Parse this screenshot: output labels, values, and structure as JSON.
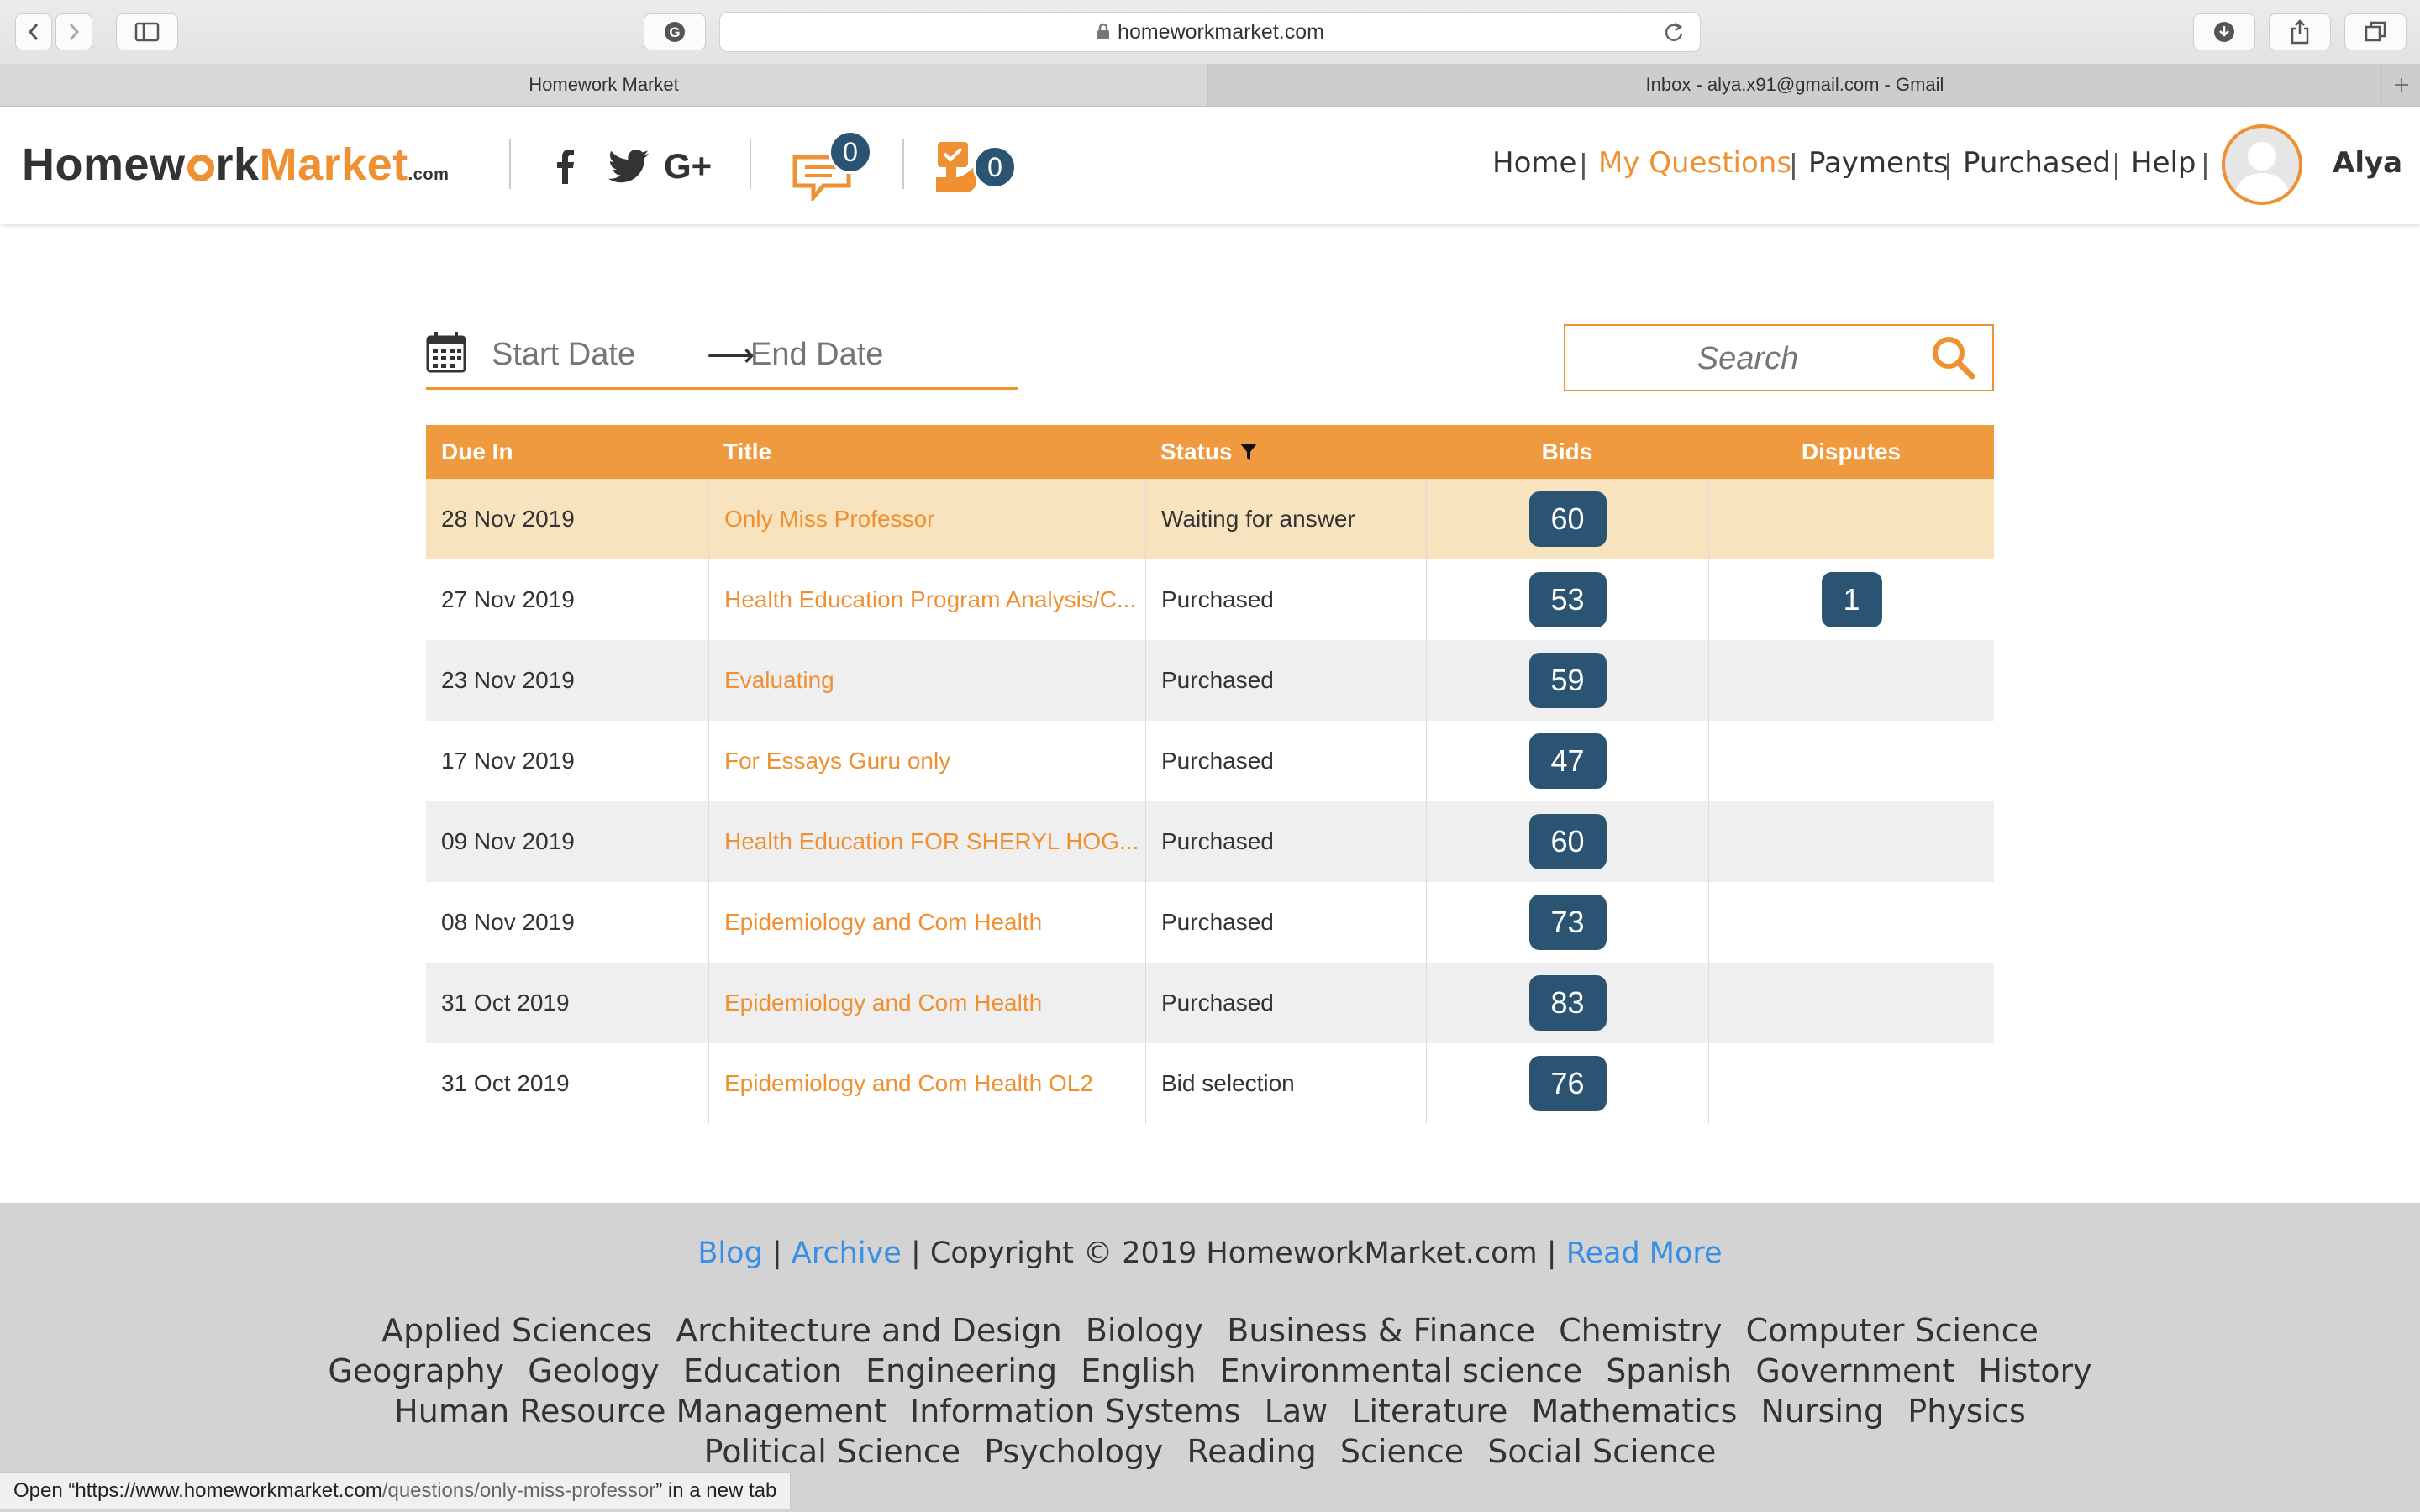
{
  "browser": {
    "url": "homeworkmarket.com",
    "tabs": [
      {
        "label": "Homework Market",
        "active": true
      },
      {
        "label": "Inbox - alya.x91@gmail.com - Gmail",
        "active": false
      }
    ],
    "status_text_prefix": "Open “",
    "status_text_url_host": "https://www.homeworkmarket.com",
    "status_text_url_path": "/questions/only-miss-professor",
    "status_text_suffix": "” in a new tab"
  },
  "header": {
    "logo_part1": "Homew",
    "logo_part2": "rk",
    "logo_part3": "Market",
    "logo_suffix": ".com",
    "messages_count": "0",
    "notifications_count": "0",
    "nav": {
      "home": "Home",
      "my_questions": "My Questions",
      "payments": "Payments",
      "purchased": "Purchased",
      "help": "Help",
      "separator": "|"
    },
    "username": "Alya"
  },
  "filters": {
    "start_date_placeholder": "Start Date",
    "end_date_placeholder": "End Date",
    "arrow": "⟶",
    "search_placeholder": "Search"
  },
  "table": {
    "columns": {
      "due_in": "Due In",
      "title": "Title",
      "status": "Status",
      "bids": "Bids",
      "disputes": "Disputes"
    },
    "rows": [
      {
        "due": "28 Nov 2019",
        "title": "Only Miss Professor",
        "status": "Waiting for answer",
        "bids": "60",
        "disputes": ""
      },
      {
        "due": "27 Nov 2019",
        "title": "Health Education Program Analysis/C...",
        "status": "Purchased",
        "bids": "53",
        "disputes": "1"
      },
      {
        "due": "23 Nov 2019",
        "title": "Evaluating",
        "status": "Purchased",
        "bids": "59",
        "disputes": ""
      },
      {
        "due": "17 Nov 2019",
        "title": "For Essays Guru only",
        "status": "Purchased",
        "bids": "47",
        "disputes": ""
      },
      {
        "due": "09 Nov 2019",
        "title": "Health Education FOR SHERYL HOG...",
        "status": "Purchased",
        "bids": "60",
        "disputes": ""
      },
      {
        "due": "08 Nov 2019",
        "title": "Epidemiology and Com Health",
        "status": "Purchased",
        "bids": "73",
        "disputes": ""
      },
      {
        "due": "31 Oct 2019",
        "title": "Epidemiology and Com Health",
        "status": "Purchased",
        "bids": "83",
        "disputes": ""
      },
      {
        "due": "31 Oct 2019",
        "title": "Epidemiology and Com Health OL2",
        "status": "Bid selection",
        "bids": "76",
        "disputes": ""
      }
    ]
  },
  "footer": {
    "blog": "Blog",
    "archive": "Archive",
    "copyright": "Copyright © 2019 HomeworkMarket.com",
    "read_more": "Read More",
    "sep": "|",
    "subjects": [
      "Applied Sciences",
      "Architecture and Design",
      "Biology",
      "Business & Finance",
      "Chemistry",
      "Computer Science",
      "Geography",
      "Geology",
      "Education",
      "Engineering",
      "English",
      "Environmental science",
      "Spanish",
      "Government",
      "History",
      "Human Resource Management",
      "Information Systems",
      "Law",
      "Literature",
      "Mathematics",
      "Nursing",
      "Physics",
      "Political Science",
      "Psychology",
      "Reading",
      "Science",
      "Social Science"
    ]
  },
  "colors": {
    "accent": "#ef9033",
    "header_row": "#ef9a3e",
    "selected_row": "#f7e3bd",
    "alt_row": "#efefef",
    "pill": "#2b5473",
    "link_blue": "#3a8ee6"
  }
}
